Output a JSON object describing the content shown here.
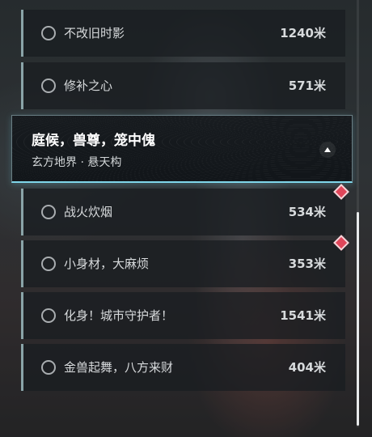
{
  "locations": [
    {
      "name": "不改旧时影",
      "distance": "1240米"
    },
    {
      "name": "修补之心",
      "distance": "571米"
    }
  ],
  "area_header": {
    "title": "庭候，兽尊，笼中傀",
    "subtitle": "玄方地界 · 悬天构",
    "collapse_icon": "chevron-up-icon"
  },
  "area_locations": [
    {
      "name": "战火炊烟",
      "distance": "534米",
      "marker": true
    },
    {
      "name": "小身材，大麻烦",
      "distance": "353米",
      "marker": true
    },
    {
      "name": "化身！城市守护者！",
      "distance": "1541米",
      "marker": false
    },
    {
      "name": "金兽起舞，八方来财",
      "distance": "404米",
      "marker": false
    }
  ],
  "colors": {
    "accent_cyan": "#7fd6ea",
    "marker_red": "#e0465a",
    "row_border": "#8aa4a8"
  }
}
